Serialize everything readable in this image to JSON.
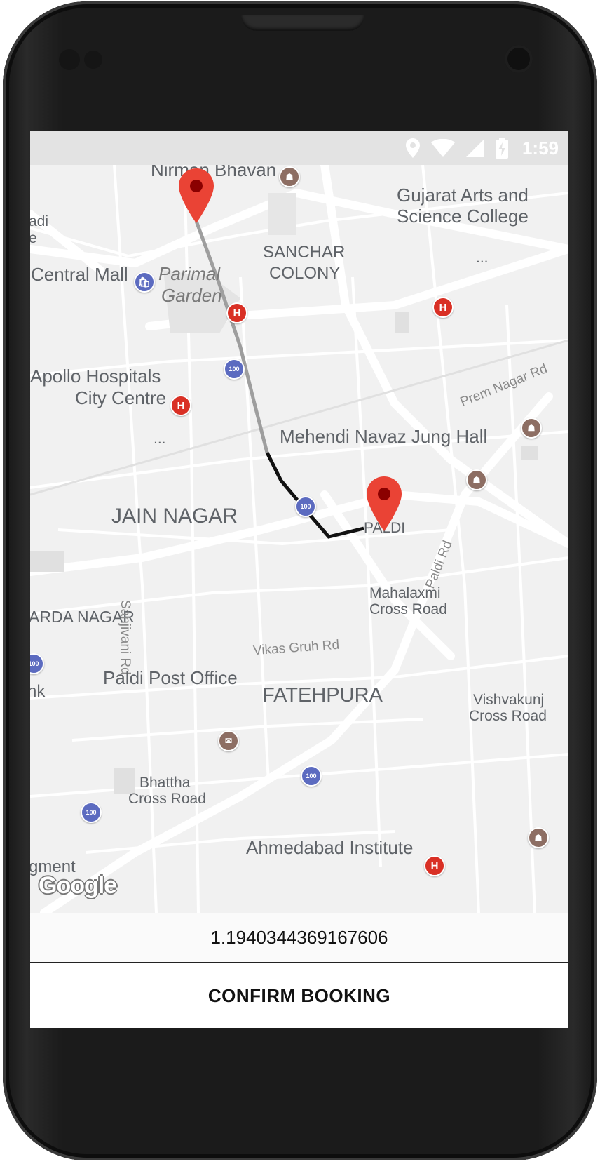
{
  "status_bar": {
    "time": "1:59",
    "icons": [
      "location-icon",
      "wifi-icon",
      "signal-icon",
      "battery-charging-icon"
    ]
  },
  "map": {
    "labels": {
      "nirman_bhavan": "Nirman Bhavan",
      "gujarat_arts": "Gujarat Arts and",
      "science_college": "Science College",
      "sanchar": "SANCHAR",
      "colony": "COLONY",
      "central_mall": "Central Mall",
      "parimal": "Parimal",
      "garden": "Garden",
      "apollo": "Apollo Hospitals",
      "city_centre": "City Centre",
      "prem_nagar": "Prem Nagar Rd",
      "mehendi": "Mehendi Navaz Jung Hall",
      "jain_nagar": "JAIN NAGAR",
      "paldi": "PALDI",
      "paldi_rd": "Paldi Rd",
      "ardha_nagar": "ARDA NAGAR",
      "sanjivani": "Sanjivani Rd",
      "mahalaxmi": "Mahalaxmi",
      "cross_road": "Cross Road",
      "vikas": "Vikas Gruh Rd",
      "paldi_post": "Paldi Post Office",
      "fatehpura": "FATEHPURA",
      "vishvakunj": "Vishvakunj",
      "vishvakunj_cross": "Cross Road",
      "bhattha": "Bhattha",
      "bhattha_cross": "Cross Road",
      "ahmedabad_inst": "Ahmedabad Institute",
      "ellipsis": "...",
      "edge_adi": "adi",
      "edge_e": "e",
      "edge_nk": "nk",
      "edge_ment": "gment"
    },
    "attribution": "Google"
  },
  "distance_text": "1.1940344369167606",
  "confirm_button": "CONFIRM BOOKING"
}
